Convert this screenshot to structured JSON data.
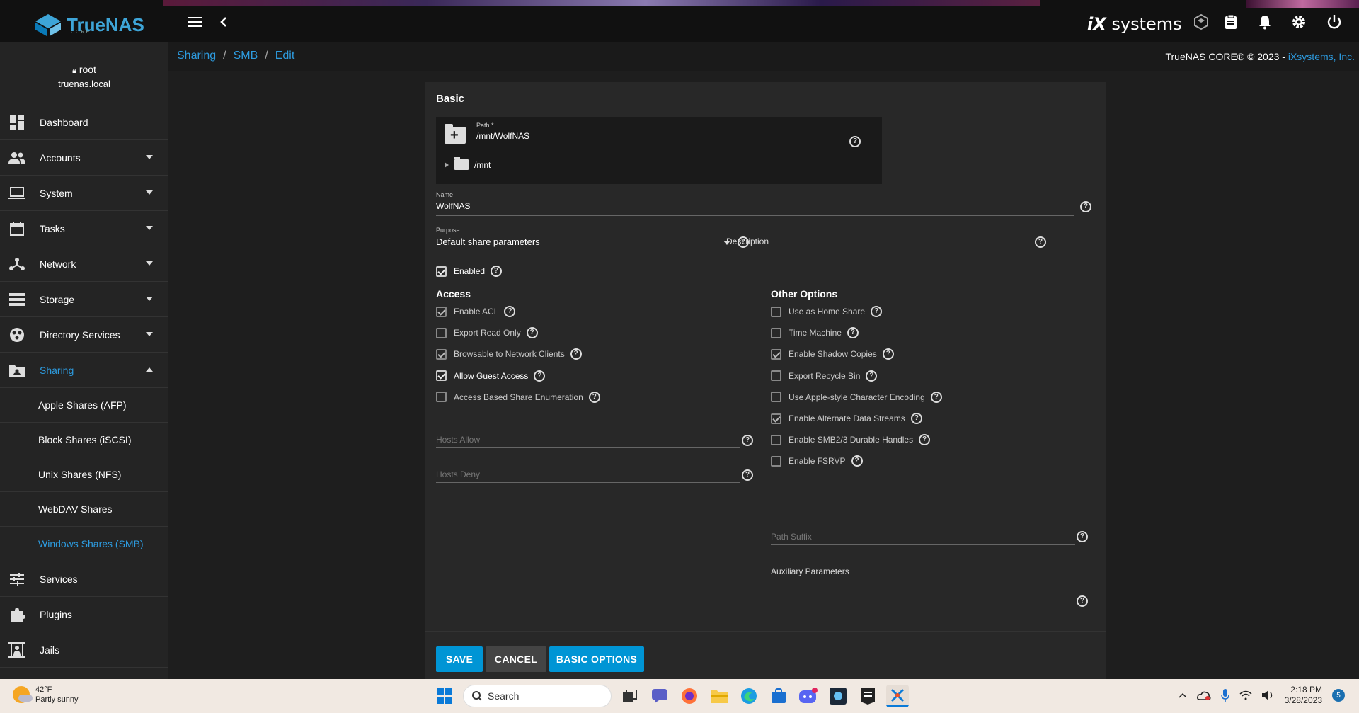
{
  "app": {
    "logo_text": "TrueNAS",
    "logo_sub": "CORE",
    "vendor_logo": "iXsystems"
  },
  "breadcrumb": [
    "Sharing",
    "SMB",
    "Edit"
  ],
  "copyright": {
    "text": "TrueNAS CORE® © 2023 - ",
    "link": "iXsystems, Inc."
  },
  "user": {
    "name": "root",
    "host": "truenas.local"
  },
  "sidebar": {
    "items": [
      {
        "label": "Dashboard",
        "icon": "dashboard-icon"
      },
      {
        "label": "Accounts",
        "icon": "people-icon"
      },
      {
        "label": "System",
        "icon": "laptop-icon"
      },
      {
        "label": "Tasks",
        "icon": "calendar-icon"
      },
      {
        "label": "Network",
        "icon": "network-icon"
      },
      {
        "label": "Storage",
        "icon": "storage-icon"
      },
      {
        "label": "Directory Services",
        "icon": "directory-icon"
      },
      {
        "label": "Sharing",
        "icon": "sharing-folder-icon"
      }
    ],
    "sharing_sub": [
      "Apple Shares (AFP)",
      "Block Shares (iSCSI)",
      "Unix Shares (NFS)",
      "WebDAV Shares",
      "Windows Shares (SMB)"
    ],
    "items_after": [
      {
        "label": "Services",
        "icon": "tune-icon"
      },
      {
        "label": "Plugins",
        "icon": "puzzle-icon"
      },
      {
        "label": "Jails",
        "icon": "jail-icon"
      }
    ]
  },
  "form": {
    "basic_title": "Basic",
    "path_label": "Path *",
    "path_value": "/mnt/WolfNAS",
    "tree_root": "/mnt",
    "name_label": "Name",
    "name_value": "WolfNAS",
    "purpose_label": "Purpose",
    "purpose_value": "Default share parameters",
    "description_placeholder": "Description",
    "enabled_label": "Enabled",
    "access_title": "Access",
    "other_title": "Other Options",
    "access_options": [
      {
        "label": "Enable ACL",
        "checked": true
      },
      {
        "label": "Export Read Only",
        "checked": false
      },
      {
        "label": "Browsable to Network Clients",
        "checked": true
      },
      {
        "label": "Allow Guest Access",
        "checked": true
      },
      {
        "label": "Access Based Share Enumeration",
        "checked": false
      }
    ],
    "hosts_allow": "Hosts Allow",
    "hosts_deny": "Hosts Deny",
    "other_options": [
      {
        "label": "Use as Home Share",
        "checked": false
      },
      {
        "label": "Time Machine",
        "checked": false
      },
      {
        "label": "Enable Shadow Copies",
        "checked": true
      },
      {
        "label": "Export Recycle Bin",
        "checked": false
      },
      {
        "label": "Use Apple-style Character Encoding",
        "checked": false
      },
      {
        "label": "Enable Alternate Data Streams",
        "checked": true
      },
      {
        "label": "Enable SMB2/3 Durable Handles",
        "checked": false
      },
      {
        "label": "Enable FSRVP",
        "checked": false
      }
    ],
    "path_suffix": "Path Suffix",
    "aux_params": "Auxiliary Parameters",
    "save_label": "SAVE",
    "cancel_label": "CANCEL",
    "basic_options_label": "BASIC OPTIONS"
  },
  "taskbar": {
    "temp": "42°F",
    "weather": "Partly sunny",
    "search": "Search",
    "time": "2:18 PM",
    "date": "3/28/2023",
    "notification_count": "5"
  },
  "colors": {
    "accent": "#0095d5",
    "link": "#2d9bdf",
    "background": "#1e1e1e",
    "card": "#282828"
  }
}
